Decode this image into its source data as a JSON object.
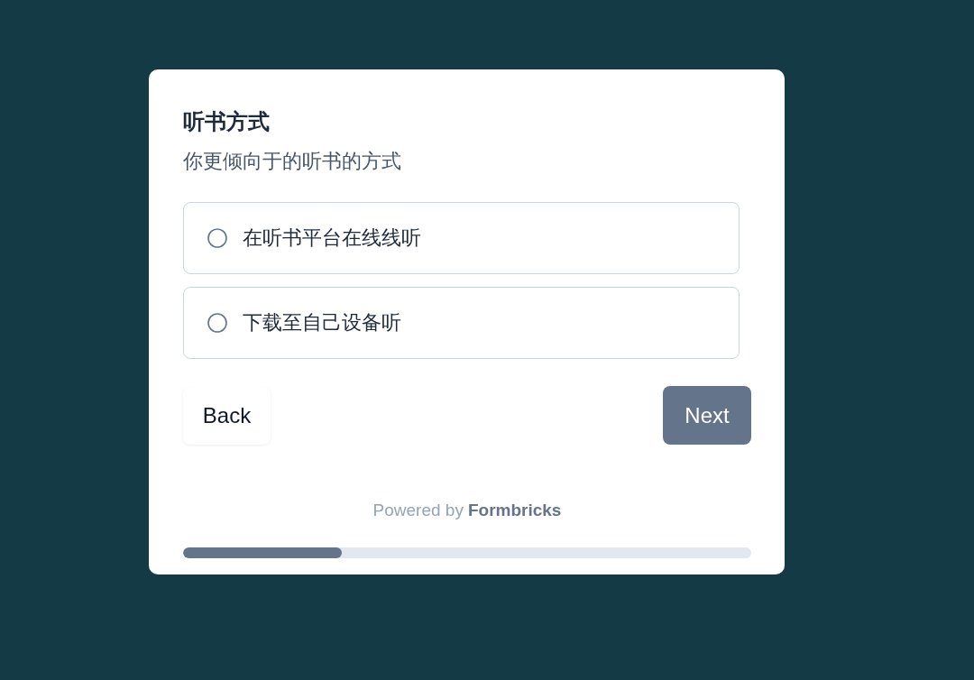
{
  "question": {
    "title": "听书方式",
    "subtitle": "你更倾向于的听书的方式"
  },
  "options": [
    {
      "label": "在听书平台在线线听",
      "selected": false
    },
    {
      "label": "下载至自己设备听",
      "selected": false
    }
  ],
  "buttons": {
    "back": "Back",
    "next": "Next"
  },
  "footer": {
    "text": "Powered by",
    "link": "Formbricks"
  },
  "progress": {
    "level": 0.28
  }
}
